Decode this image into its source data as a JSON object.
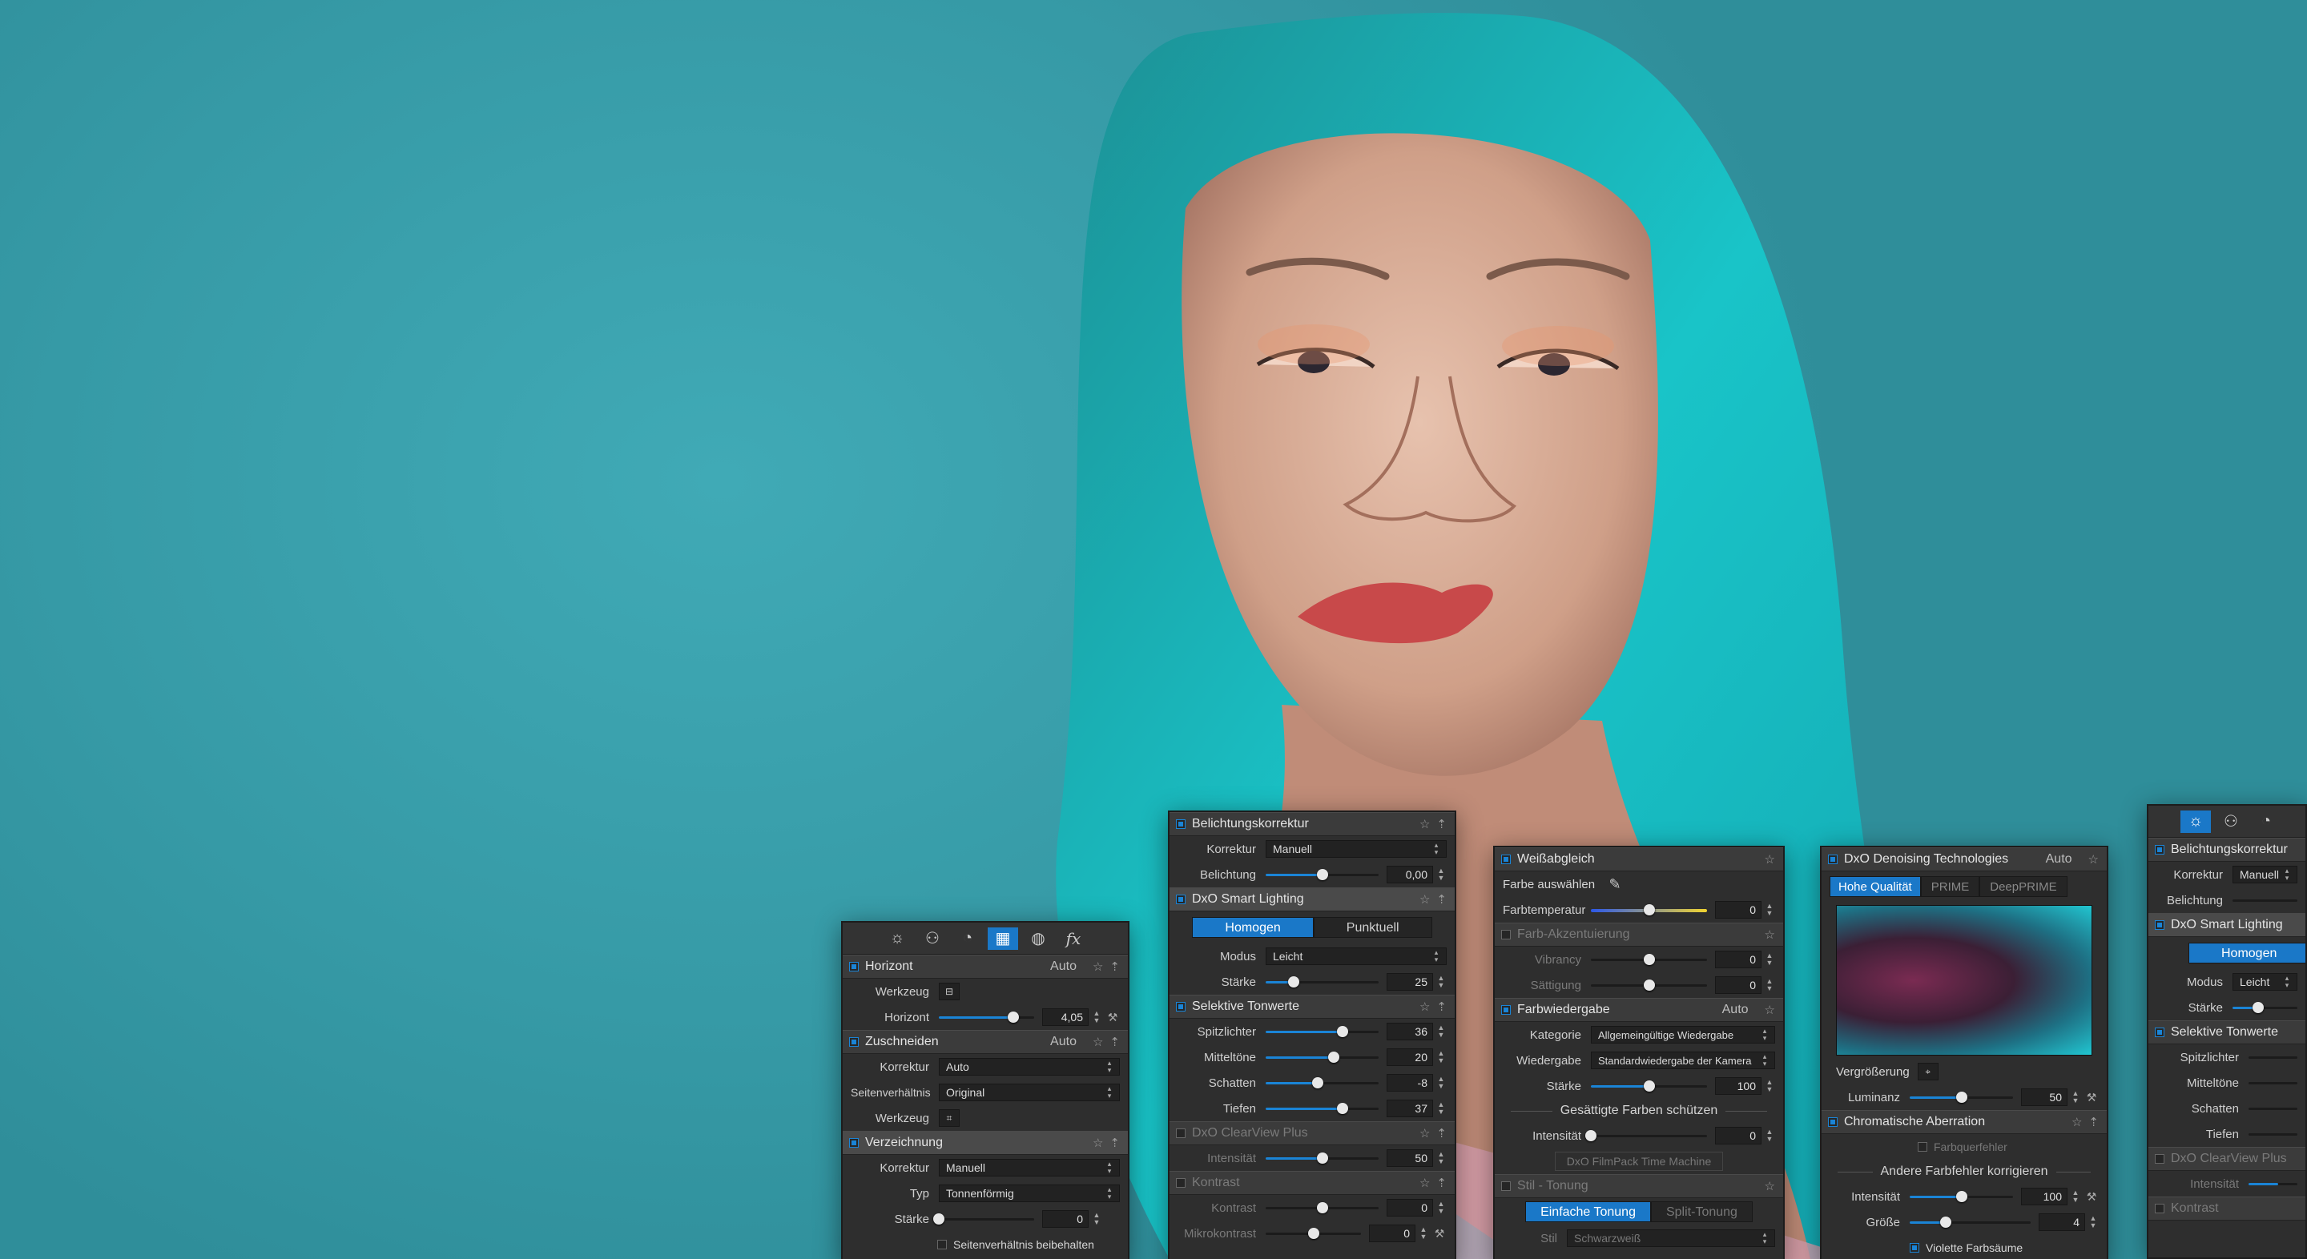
{
  "tabs": [
    {
      "icon": "sun-icon",
      "glyph": "☼"
    },
    {
      "icon": "color-circles-icon",
      "glyph": "⚇"
    },
    {
      "icon": "lens-icon",
      "glyph": "◔"
    },
    {
      "icon": "geometry-icon",
      "glyph": "▦"
    },
    {
      "icon": "local-adjust-icon",
      "glyph": "◍"
    },
    {
      "icon": "fx-icon",
      "glyph": "fx"
    }
  ],
  "geometry_panel": {
    "horizont": {
      "title": "Horizont",
      "auto": "Auto",
      "werkzeug_label": "Werkzeug",
      "horizont_label": "Horizont",
      "horizont_value": "4,05",
      "horizont_pos": 0.78
    },
    "zuschneiden": {
      "title": "Zuschneiden",
      "auto": "Auto",
      "korrektur_label": "Korrektur",
      "korrektur_value": "Auto",
      "ratio_label": "Seitenverhältnis",
      "ratio_value": "Original",
      "werkzeug_label": "Werkzeug"
    },
    "verzeichnung": {
      "title": "Verzeichnung",
      "korrektur_label": "Korrektur",
      "korrektur_value": "Manuell",
      "typ_label": "Typ",
      "typ_value": "Tonnenförmig",
      "staerke_label": "Stärke",
      "staerke_value": "0",
      "staerke_pos": 0.0,
      "keep_ratio": "Seitenverhältnis beibehalten"
    }
  },
  "light_panel": {
    "belichtung": {
      "title": "Belichtungskorrektur",
      "korrektur_label": "Korrektur",
      "korrektur_value": "Manuell",
      "belichtung_label": "Belichtung",
      "belichtung_value": "0,00",
      "belichtung_pos": 0.5
    },
    "smart_lighting": {
      "title": "DxO Smart Lighting",
      "btn_homogen": "Homogen",
      "btn_punktuell": "Punktuell",
      "modus_label": "Modus",
      "modus_value": "Leicht",
      "staerke_label": "Stärke",
      "staerke_value": "25",
      "staerke_pos": 0.25
    },
    "selektive": {
      "title": "Selektive Tonwerte",
      "spitz_label": "Spitzlichter",
      "spitz_value": "36",
      "spitz_pos": 0.68,
      "mittel_label": "Mitteltöne",
      "mittel_value": "20",
      "mittel_pos": 0.6,
      "schatten_label": "Schatten",
      "schatten_value": "-8",
      "schatten_pos": 0.46,
      "tiefen_label": "Tiefen",
      "tiefen_value": "37",
      "tiefen_pos": 0.68
    },
    "clearview": {
      "title": "DxO ClearView Plus",
      "intens_label": "Intensität",
      "intens_value": "50",
      "intens_pos": 0.5
    },
    "kontrast": {
      "title": "Kontrast",
      "kontrast_label": "Kontrast",
      "kontrast_value": "0",
      "kontrast_pos": 0.5,
      "mikro_label": "Mikrokontrast",
      "mikro_value": "0",
      "mikro_pos": 0.5
    }
  },
  "color_panel": {
    "weiss": {
      "title": "Weißabgleich",
      "pick_label": "Farbe auswählen",
      "temp_label": "Farbtemperatur",
      "temp_value": "0",
      "temp_pos": 0.5
    },
    "akzent": {
      "title": "Farb-Akzentuierung",
      "vib_label": "Vibrancy",
      "vib_value": "0",
      "vib_pos": 0.5,
      "sat_label": "Sättigung",
      "sat_value": "0",
      "sat_pos": 0.5
    },
    "wiedergabe": {
      "title": "Farbwiedergabe",
      "auto": "Auto",
      "kat_label": "Kategorie",
      "kat_value": "Allgemeingültige Wiedergabe",
      "wied_label": "Wiedergabe",
      "wied_value": "Standardwiedergabe der Kamera",
      "staerke_label": "Stärke",
      "staerke_value": "100",
      "staerke_pos": 0.5,
      "protect_title": "Gesättigte Farben schützen",
      "intens_label": "Intensität",
      "intens_value": "0",
      "intens_pos": 0.0,
      "filmpack": "DxO FilmPack Time Machine"
    },
    "stil": {
      "title": "Stil - Tonung",
      "btn_einfach": "Einfache Tonung",
      "btn_split": "Split-Tonung",
      "stil_label": "Stil",
      "stil_value": "Schwarzweiß"
    }
  },
  "denoise_panel": {
    "denoise": {
      "title": "DxO Denoising Technologies",
      "auto": "Auto",
      "btn_hq": "Hohe Qualität",
      "btn_prime": "PRIME",
      "btn_deep": "DeepPRIME",
      "zoom_label": "Vergrößerung",
      "lum_label": "Luminanz",
      "lum_value": "50",
      "lum_pos": 0.5
    },
    "chroma": {
      "title": "Chromatische Aberration",
      "farbquer": "Farbquerfehler",
      "other_title": "Andere Farbfehler korrigieren",
      "intens_label": "Intensität",
      "intens_value": "100",
      "intens_pos": 0.5,
      "groesse_label": "Größe",
      "groesse_value": "4",
      "groesse_pos": 0.3,
      "violett": "Violette Farbsäume"
    }
  },
  "right_panel": {
    "belichtung_title": "Belichtungskorrektur",
    "korrektur_label": "Korrektur",
    "korrektur_value": "Manuell",
    "belichtung_label": "Belichtung",
    "smart_title": "DxO Smart Lighting",
    "btn_homogen": "Homogen",
    "modus_label": "Modus",
    "modus_value": "Leicht",
    "staerke_label": "Stärke",
    "selektive_title": "Selektive Tonwerte",
    "spitz_label": "Spitzlichter",
    "mittel_label": "Mitteltöne",
    "schatten_label": "Schatten",
    "tiefen_label": "Tiefen",
    "clearview_title": "DxO ClearView Plus",
    "intens_label": "Intensität",
    "kontrast_title": "Kontrast"
  }
}
